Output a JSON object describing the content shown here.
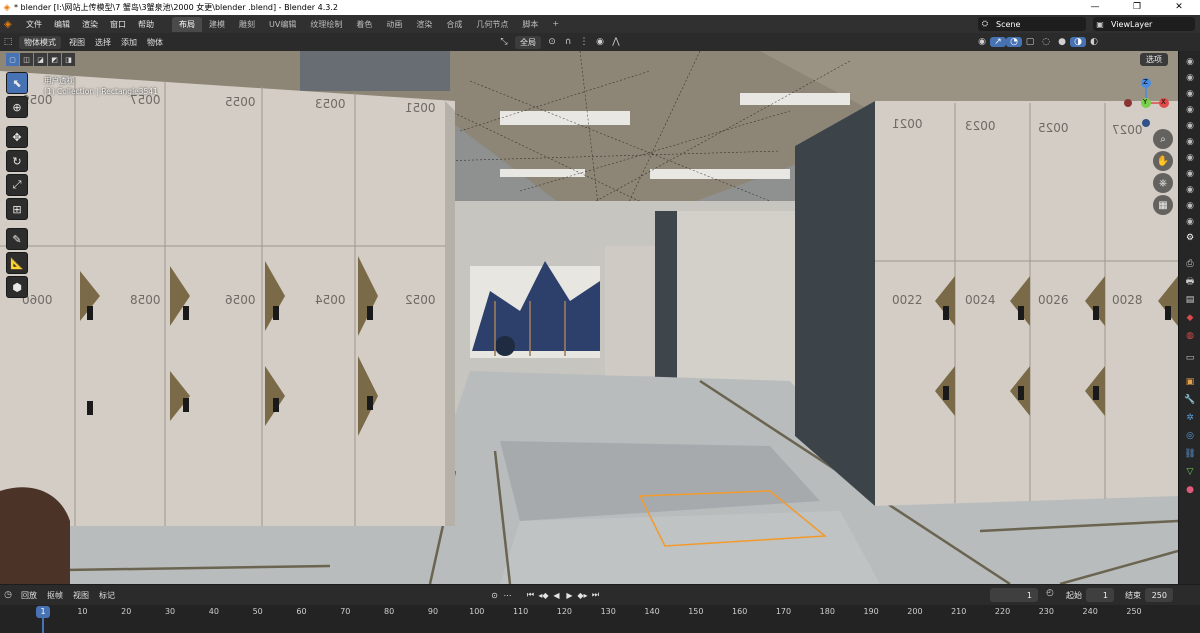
{
  "window": {
    "title": "* blender  [I:\\网站上传模型\\7 蟹岛\\3蟹泉池\\2000 女更\\blender .blend] - Blender 4.3.2",
    "controls": [
      "—",
      "❐",
      "✕"
    ]
  },
  "menu": {
    "items": [
      "文件",
      "编辑",
      "渲染",
      "窗口",
      "帮助"
    ],
    "workspaces": [
      "布局",
      "建模",
      "雕刻",
      "UV编辑",
      "纹理绘制",
      "着色",
      "动画",
      "渲染",
      "合成",
      "几何节点",
      "脚本",
      "+"
    ],
    "active_workspace": "布局",
    "scene": "Scene",
    "view_layer": "ViewLayer"
  },
  "viewport_header": {
    "mode": "物体模式",
    "menus": [
      "视图",
      "选择",
      "添加",
      "物体"
    ],
    "orientation": "全局",
    "options_label": "选项"
  },
  "viewport": {
    "view_name": "用户透视",
    "collection_info": "(1) Collection | Rectangle3541",
    "locker_numbers_left_top": [
      "0059",
      "0057",
      "0055",
      "0053",
      "0051"
    ],
    "locker_numbers_left_mid": [
      "0060",
      "0058",
      "0056",
      "0054",
      "0052"
    ],
    "locker_numbers_right_top": [
      "0021",
      "0023",
      "0025",
      "0027"
    ],
    "locker_numbers_right_mid": [
      "0022",
      "0024",
      "0026",
      "0028"
    ],
    "gizmo_axes": [
      "X",
      "Y",
      "Z"
    ],
    "colors": {
      "ceiling": "#8d8676",
      "locker": "#d3cdc5",
      "floor": "#b9bcbd",
      "panel": "#3d4449",
      "selection": "#f39a2c",
      "accent_blue": "#4772b3"
    }
  },
  "tools": [
    "cursor-select",
    "cursor-3d",
    "move",
    "rotate",
    "scale",
    "transform",
    "annotate",
    "measure",
    "add-cube"
  ],
  "timeline": {
    "menus": [
      "回放",
      "抠帧",
      "视图",
      "标记"
    ],
    "current_frame": "1",
    "start_label": "起始",
    "start": "1",
    "end_label": "结束",
    "end": "250",
    "frame_labels": [
      "1",
      "10",
      "20",
      "30",
      "40",
      "50",
      "60",
      "70",
      "80",
      "90",
      "100",
      "110",
      "120",
      "130",
      "140",
      "150",
      "160",
      "170",
      "180",
      "190",
      "200",
      "210",
      "220",
      "230",
      "240",
      "250"
    ]
  }
}
